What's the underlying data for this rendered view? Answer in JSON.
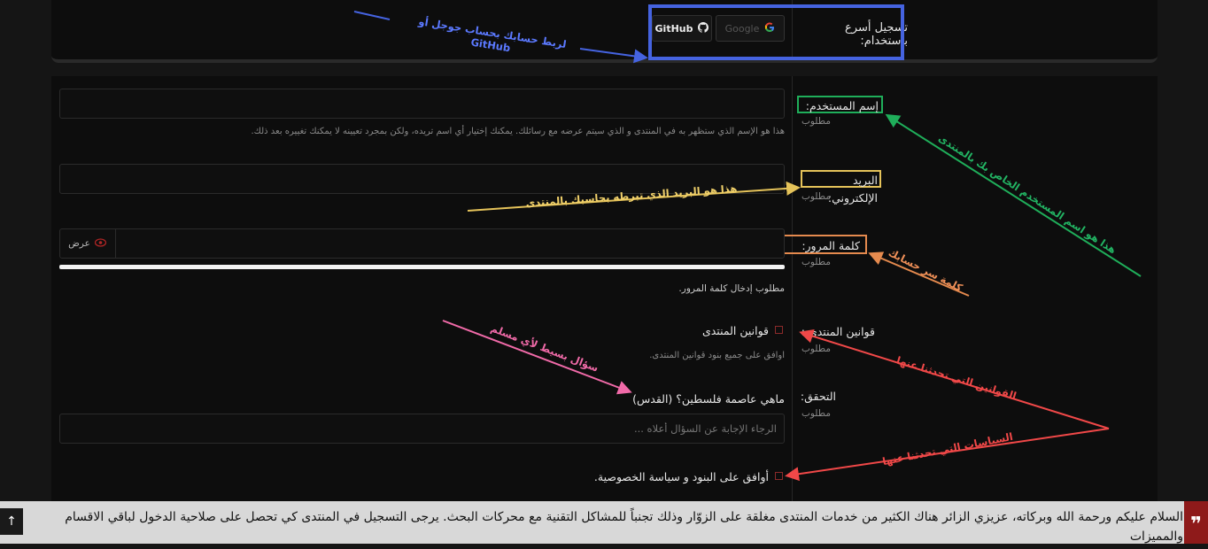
{
  "quick_signup": {
    "label": "تسجيل أسرع باستخدام:",
    "google_label": "Google",
    "github_label": "GitHub"
  },
  "form": {
    "username": {
      "label": "إسم المستخدم:",
      "required": "مطلوب",
      "value": "",
      "hint": "هذا هو الإسم الذي ستظهر به في المنتدى و الذي سيتم عرضه مع رسائلك. يمكنك إختيار أي اسم تريده، ولكن بمجرد تعيينه لا يمكنك تغييره بعد ذلك."
    },
    "email": {
      "label": "البريد الإلكتروني:",
      "required": "مطلوب",
      "value": ""
    },
    "password": {
      "label": "كلمة المرور:",
      "required": "مطلوب",
      "value": "",
      "show_label": "عرض",
      "hint": "مطلوب إدخال كلمة المرور."
    },
    "rules": {
      "label": "قوانين المنتدى :",
      "required": "مطلوب",
      "checkbox_label": "قوانين المنتدى",
      "hint": "اوافق على جميع بنود قوانين المنتدى."
    },
    "verification": {
      "label": "التحقق:",
      "required": "مطلوب",
      "question": "ماهي عاصمة فلسطين؟ (القدس)",
      "placeholder": "الرجاء الإجابة عن السؤال أعلاه ..."
    },
    "terms": {
      "checkbox_label": "أوافق على البنود و سياسة الخصوصية."
    }
  },
  "annotations": {
    "blue": "لربط حسابك بحساب جوجل أو GitHub",
    "green": "هذا هو اسم المستخدم الخاص بك بالمنتدى",
    "yellow": "هذا هو البريد الذي تبرطه بحاسبك بالمنتدى",
    "orange": "كلمة سر حسابك",
    "pink": "سؤال بسيط لأي مسلم",
    "red_rules": "القوانين التي تحدثنا عنها",
    "red_policies": "السياسات التي تحدثنا عنها"
  },
  "notice": {
    "text": "السلام عليكم ورحمة الله وبركاته، عزيزي الزائر هناك الكثير من خدمات المنتدى مغلقة على الزوّار وذلك تجنباً للمشاكل التقنية مع محركات البحث. يرجى التسجيل في المنتدى كي تحصل على صلاحية الدخول لباقي الاقسام والمميزات"
  },
  "colors": {
    "blue": "#4563e0",
    "green": "#1fae5a",
    "yellow": "#e5c35a",
    "orange": "#e58a4e",
    "pink": "#f06aa8",
    "red": "#f04848"
  }
}
